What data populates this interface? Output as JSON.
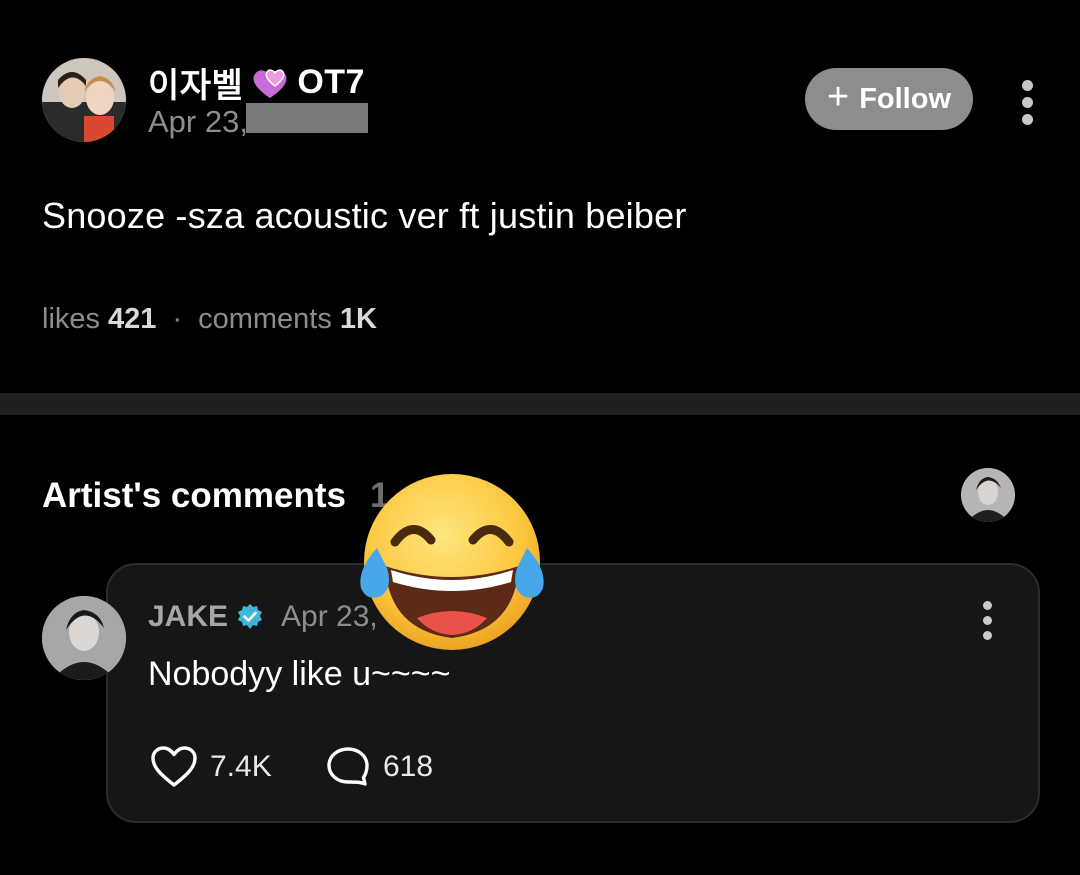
{
  "post": {
    "username": "이자벨",
    "username_suffix": "OT7",
    "date": "Apr 23,",
    "follow_label": "Follow",
    "text": "Snooze -sza acoustic ver ft justin beiber",
    "likes_label": "likes",
    "likes_count": "421",
    "comments_label": "comments",
    "comments_count": "1K",
    "separator": "·"
  },
  "artist_comments": {
    "title": "Artist's comments",
    "count": "1"
  },
  "comment": {
    "author": "JAKE",
    "date": "Apr 23,",
    "text": "Nobodyy like u~~~~",
    "likes": "7.4K",
    "replies": "618"
  },
  "icons": {
    "heart_emoji": "two-hearts-icon",
    "verified": "verified-badge-icon",
    "like": "heart-outline-icon",
    "reply": "speech-bubble-icon",
    "more": "more-vertical-icon",
    "sticker": "tears-of-joy-emoji"
  },
  "colors": {
    "background": "#000000",
    "follow_button": "#8d8d8d",
    "muted_text": "#8d8d8d",
    "verified": "#3fb6d8",
    "card": "#161616"
  }
}
